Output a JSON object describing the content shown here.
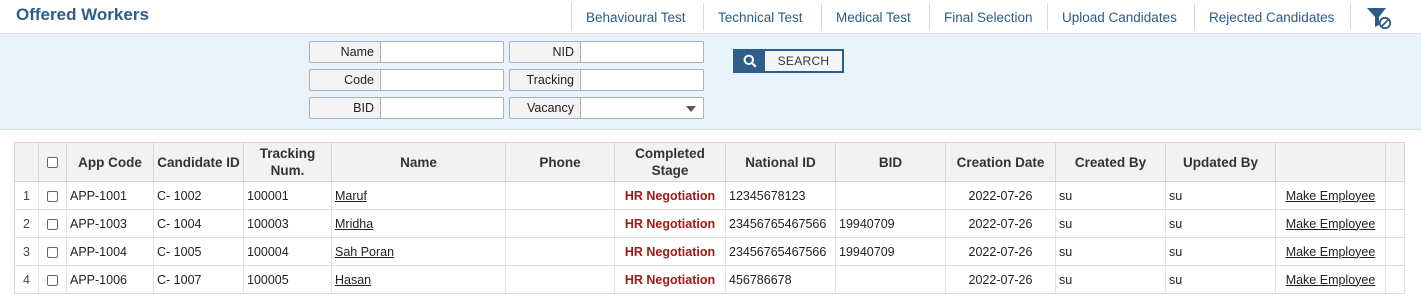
{
  "header": {
    "title": "Offered Workers",
    "nav": [
      "Behavioural Test",
      "Technical Test",
      "Medical Test",
      "Final Selection",
      "Upload Candidates",
      "Rejected Candidates"
    ]
  },
  "search": {
    "labels": {
      "name": "Name",
      "nid": "NID",
      "code": "Code",
      "tracking": "Tracking",
      "bid": "BID",
      "vacancy": "Vacancy"
    },
    "values": {
      "name": "",
      "nid": "",
      "code": "",
      "tracking": "",
      "bid": "",
      "vacancy": ""
    },
    "button_label": "SEARCH"
  },
  "table": {
    "columns": [
      "",
      "",
      "App Code",
      "Candidate ID",
      "Tracking Num.",
      "Name",
      "Phone",
      "Completed Stage",
      "National ID",
      "BID",
      "Creation Date",
      "Created By",
      "Updated By",
      ""
    ],
    "rows": [
      {
        "no": "1",
        "app_code": "APP-1001",
        "candidate_id": "C- 1002",
        "tracking": "100001",
        "name": "Maruf",
        "phone": "",
        "stage": "HR Negotiation",
        "national_id": "12345678123",
        "bid": "",
        "created": "2022-07-26",
        "created_by": "su",
        "updated_by": "su",
        "action": "Make Employee"
      },
      {
        "no": "2",
        "app_code": "APP-1003",
        "candidate_id": "C- 1004",
        "tracking": "100003",
        "name": "Mridha",
        "phone": "",
        "stage": "HR Negotiation",
        "national_id": "23456765467566",
        "bid": "19940709",
        "created": "2022-07-26",
        "created_by": "su",
        "updated_by": "su",
        "action": "Make Employee"
      },
      {
        "no": "3",
        "app_code": "APP-1004",
        "candidate_id": "C- 1005",
        "tracking": "100004",
        "name": "Sah Poran",
        "phone": "",
        "stage": "HR Negotiation",
        "national_id": "23456765467566",
        "bid": "19940709",
        "created": "2022-07-26",
        "created_by": "su",
        "updated_by": "su",
        "action": "Make Employee"
      },
      {
        "no": "4",
        "app_code": "APP-1006",
        "candidate_id": "C- 1007",
        "tracking": "100005",
        "name": "Hasan",
        "phone": "",
        "stage": "HR Negotiation",
        "national_id": "456786678",
        "bid": "",
        "created": "2022-07-26",
        "created_by": "su",
        "updated_by": "su",
        "action": "Make Employee"
      }
    ]
  },
  "colors": {
    "brand": "#2f5d8a",
    "stage": "#a01818",
    "panel": "#e8f3fb"
  },
  "icons": {
    "filter": "filter-clear-icon",
    "search": "search-icon"
  }
}
